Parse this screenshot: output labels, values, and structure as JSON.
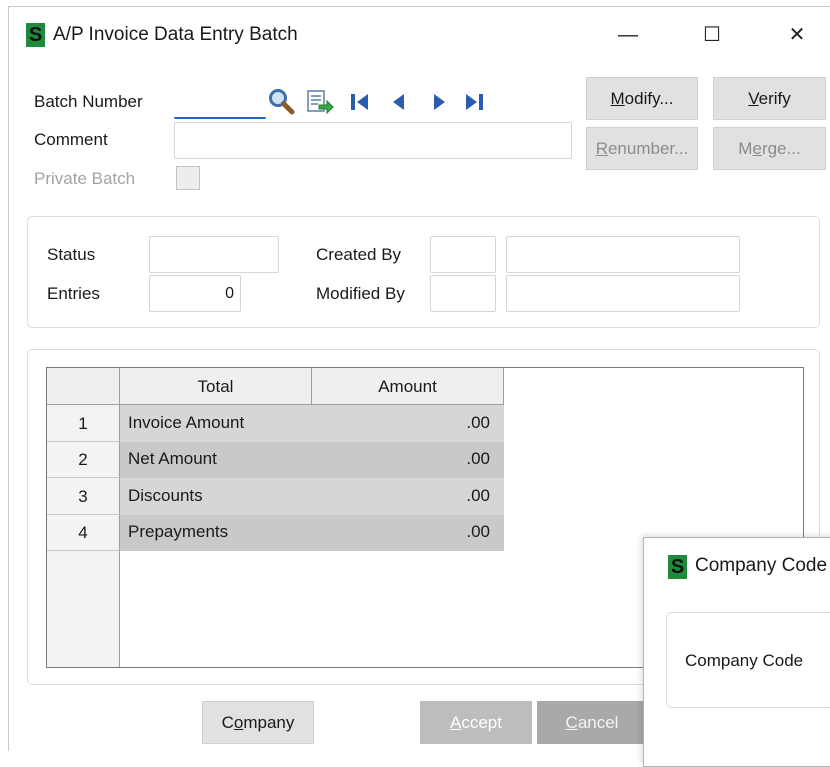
{
  "window": {
    "title": "A/P Invoice Data Entry Batch",
    "controls": {
      "minimize": "—",
      "maximize": "☐",
      "close": "✕"
    }
  },
  "logo_glyph": "S",
  "form": {
    "batch_number_label": "Batch Number",
    "batch_number_value": "",
    "comment_label": "Comment",
    "comment_value": "",
    "private_batch_label": "Private Batch",
    "private_batch_checked": false
  },
  "nav_icons": [
    "search-icon",
    "batch-list-icon",
    "first-record-icon",
    "previous-record-icon",
    "next-record-icon",
    "last-record-icon"
  ],
  "buttons": {
    "modify": {
      "pre": "",
      "u": "M",
      "post": "odify..."
    },
    "verify": {
      "pre": "",
      "u": "V",
      "post": "erify"
    },
    "renumber": {
      "pre": "",
      "u": "R",
      "post": "enumber..."
    },
    "merge": {
      "pre": "M",
      "u": "e",
      "post": "rge..."
    },
    "company": {
      "pre": "C",
      "u": "o",
      "post": "mpany"
    },
    "accept": {
      "pre": "",
      "u": "A",
      "post": "ccept"
    },
    "cancel": {
      "pre": "",
      "u": "C",
      "post": "ancel"
    }
  },
  "status_section": {
    "status_label": "Status",
    "status_value": "",
    "entries_label": "Entries",
    "entries_value": "0",
    "created_by_label": "Created By",
    "created_by_code": "",
    "created_by_name": "",
    "modified_by_label": "Modified By",
    "modified_by_code": "",
    "modified_by_name": ""
  },
  "totals_grid": {
    "columns": [
      "Total",
      "Amount"
    ],
    "rows": [
      {
        "num": "1",
        "total": "Invoice Amount",
        "amount": ".00"
      },
      {
        "num": "2",
        "total": "Net Amount",
        "amount": ".00"
      },
      {
        "num": "3",
        "total": "Discounts",
        "amount": ".00"
      },
      {
        "num": "4",
        "total": "Prepayments",
        "amount": ".00"
      }
    ]
  },
  "company_popup": {
    "title": "Company Code",
    "field_label": "Company Code"
  },
  "colors": {
    "accent_blue": "#1a66c0",
    "logo_green": "#1f8a3b",
    "nav_blue": "#2a5db0"
  }
}
